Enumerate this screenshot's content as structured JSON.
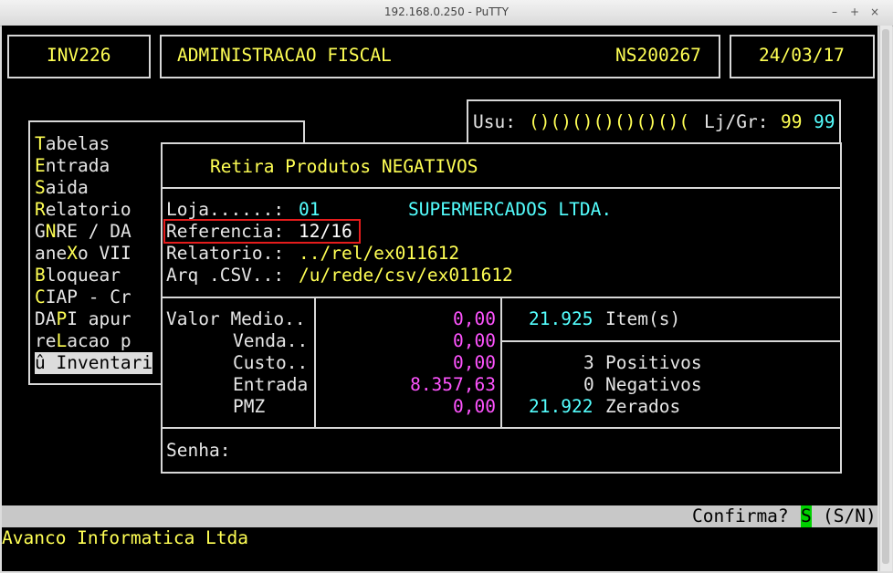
{
  "window": {
    "title": "192.168.0.250 - PuTTY",
    "min": "–",
    "max": "+",
    "close": "×"
  },
  "header": {
    "program": "INV226",
    "system": "ADMINISTRACAO FISCAL",
    "code": "NS200267",
    "date": "24/03/17"
  },
  "user": {
    "label": "Usu:",
    "value": "()()()()()()()(",
    "store_label": "Lj/Gr:",
    "store": "99",
    "group": "99"
  },
  "menu": [
    {
      "hot": "T",
      "rest": "abelas"
    },
    {
      "hot": "E",
      "rest": "ntrada"
    },
    {
      "hot": "S",
      "rest": "aida"
    },
    {
      "hot": "R",
      "rest": "elatorio"
    },
    {
      "pre": "G",
      "hot": "N",
      "rest": "RE / DA"
    },
    {
      "pre": "ane",
      "hot": "X",
      "rest": "o VII"
    },
    {
      "hot": "B",
      "rest": "loquear"
    },
    {
      "hot": "C",
      "rest": "IAP - Cr"
    },
    {
      "pre": "DA",
      "hot": "P",
      "rest": "I apur"
    },
    {
      "pre": "re",
      "hot": "L",
      "rest": "acao p"
    },
    {
      "pre": "û ",
      "hot": "I",
      "rest": "nventari"
    }
  ],
  "dialog": {
    "title": "Retira Produtos NEGATIVOS",
    "loja_label": "Loja......:",
    "loja_value": "01",
    "loja_name": "SUPERMERCADOS LTDA.",
    "ref_label": "Referencia:",
    "ref_value": "12/16",
    "rel_label": "Relatorio.:",
    "rel_value": "../rel/ex011612",
    "csv_label": "Arq .CSV..:",
    "csv_value": "/u/rede/csv/ex011612",
    "valor_medio_label": "Valor Medio..",
    "values": [
      {
        "label": "",
        "value": "0,00"
      },
      {
        "label": "Venda..",
        "value": "0,00"
      },
      {
        "label": "Custo..",
        "value": "0,00"
      },
      {
        "label": "Entrada",
        "value": "8.357,63"
      },
      {
        "label": "PMZ",
        "value": "0,00"
      }
    ],
    "items_count": "21.925",
    "items_label": "Item(s)",
    "positivos_count": "3",
    "positivos_label": "Positivos",
    "negativos_count": "0",
    "negativos_label": "Negativos",
    "zerados_count": "21.922",
    "zerados_label": "Zerados",
    "senha_label": "Senha:"
  },
  "status": {
    "confirm_label": "Confirma?",
    "confirm_value": "S",
    "confirm_options": "(S/N)",
    "company": "Avanco Informatica Ltda"
  },
  "colors": {
    "highlight": "#e51c1c",
    "cursor": "#00d000",
    "status_bar": "#c8c8c8"
  }
}
